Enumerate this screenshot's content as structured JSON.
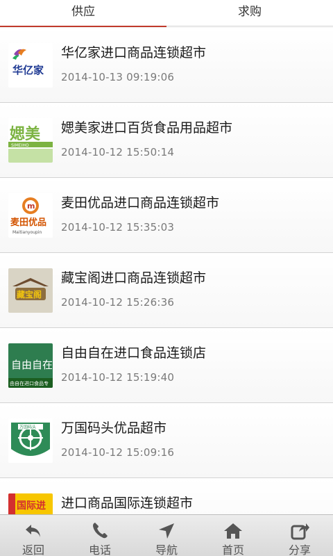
{
  "tabs": [
    {
      "label": "供应",
      "active": true
    },
    {
      "label": "求购",
      "active": false
    }
  ],
  "items": [
    {
      "title": "华亿家进口商品连锁超市",
      "date": "2014-10-13 09:19:06",
      "logo_text": "华亿家"
    },
    {
      "title": "媤美家进口百货食品用品超市",
      "date": "2014-10-12 15:50:14",
      "logo_text": "媤美",
      "logo_subtext": "SIMEIHO"
    },
    {
      "title": "麦田优品进口商品连锁超市",
      "date": "2014-10-12 15:35:03",
      "logo_text": "麦田优品",
      "logo_subtext": "Maitianyoupin"
    },
    {
      "title": "藏宝阁进口商品连锁超市",
      "date": "2014-10-12 15:26:36",
      "logo_text": "藏宝阁"
    },
    {
      "title": "自由自在进口食品连锁店",
      "date": "2014-10-12 15:19:40",
      "logo_text": "自由自在",
      "logo_subtext": "由自在进口食品专"
    },
    {
      "title": "万国码头优品超市",
      "date": "2014-10-12 15:09:16",
      "logo_text": "万国码头"
    },
    {
      "title": "进口商品国际连锁超市",
      "date": "",
      "logo_text": "国际进"
    }
  ],
  "bottom_nav": [
    {
      "label": "返回",
      "icon": "back-arrow-icon"
    },
    {
      "label": "电话",
      "icon": "phone-icon"
    },
    {
      "label": "导航",
      "icon": "navigation-icon"
    },
    {
      "label": "首页",
      "icon": "home-icon"
    },
    {
      "label": "分享",
      "icon": "share-icon"
    }
  ],
  "colors": {
    "accent": "#c0392b",
    "icon": "#555555"
  }
}
